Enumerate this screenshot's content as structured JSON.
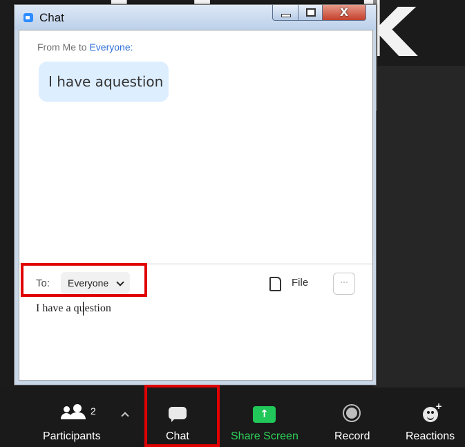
{
  "window": {
    "title": "Chat"
  },
  "messages": [
    {
      "from": "From Me to ",
      "to": "Everyone:",
      "text": "I have aquestion"
    }
  ],
  "compose": {
    "to_label": "To:",
    "recipient": "Everyone",
    "file_label": "File",
    "more_label": "···",
    "input_value": "I have a question"
  },
  "toolbar": {
    "participants": {
      "label": "Participants",
      "count": "2"
    },
    "chat": {
      "label": "Chat"
    },
    "share_screen": {
      "label": "Share Screen"
    },
    "record": {
      "label": "Record"
    },
    "reactions": {
      "label": "Reactions"
    }
  },
  "colors": {
    "highlight": "#e00000",
    "share_green": "#22c75a",
    "link_blue": "#2d6fd6"
  }
}
